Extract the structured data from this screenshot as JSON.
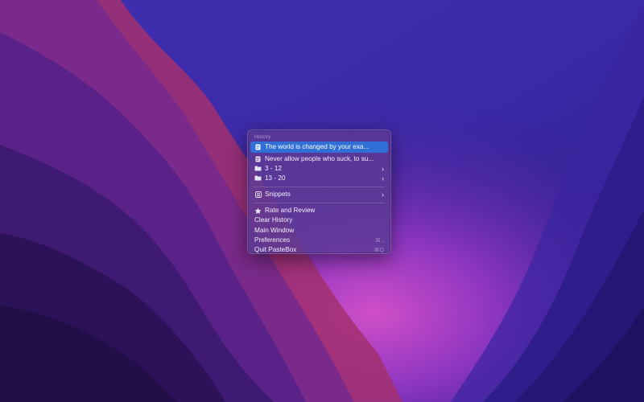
{
  "menu": {
    "section_header": "History",
    "history_items": [
      {
        "label": "The world is changed by your exa...",
        "icon": "document-icon",
        "selected": true
      },
      {
        "label": "Never allow people who suck, to su...",
        "icon": "document-icon",
        "selected": false
      }
    ],
    "folders": [
      {
        "label": "3 - 12",
        "icon": "folder-icon"
      },
      {
        "label": "13 - 20",
        "icon": "folder-icon"
      }
    ],
    "snippets": {
      "label": "Snippets",
      "icon": "snippets-icon"
    },
    "rate": {
      "label": "Rate and Review",
      "icon": "star-icon"
    },
    "clear_history": {
      "label": "Clear History"
    },
    "main_window": {
      "label": "Main Window"
    },
    "preferences": {
      "label": "Preferences",
      "shortcut": "⌘ ,"
    },
    "quit": {
      "label": "Quit PasteBox",
      "shortcut": "⌘Q"
    },
    "submenu_indicator": "›"
  },
  "colors": {
    "selection": "#2f6fd6",
    "menu_background": "#5c3a94",
    "wallpaper_base": "#2a1a6e"
  }
}
